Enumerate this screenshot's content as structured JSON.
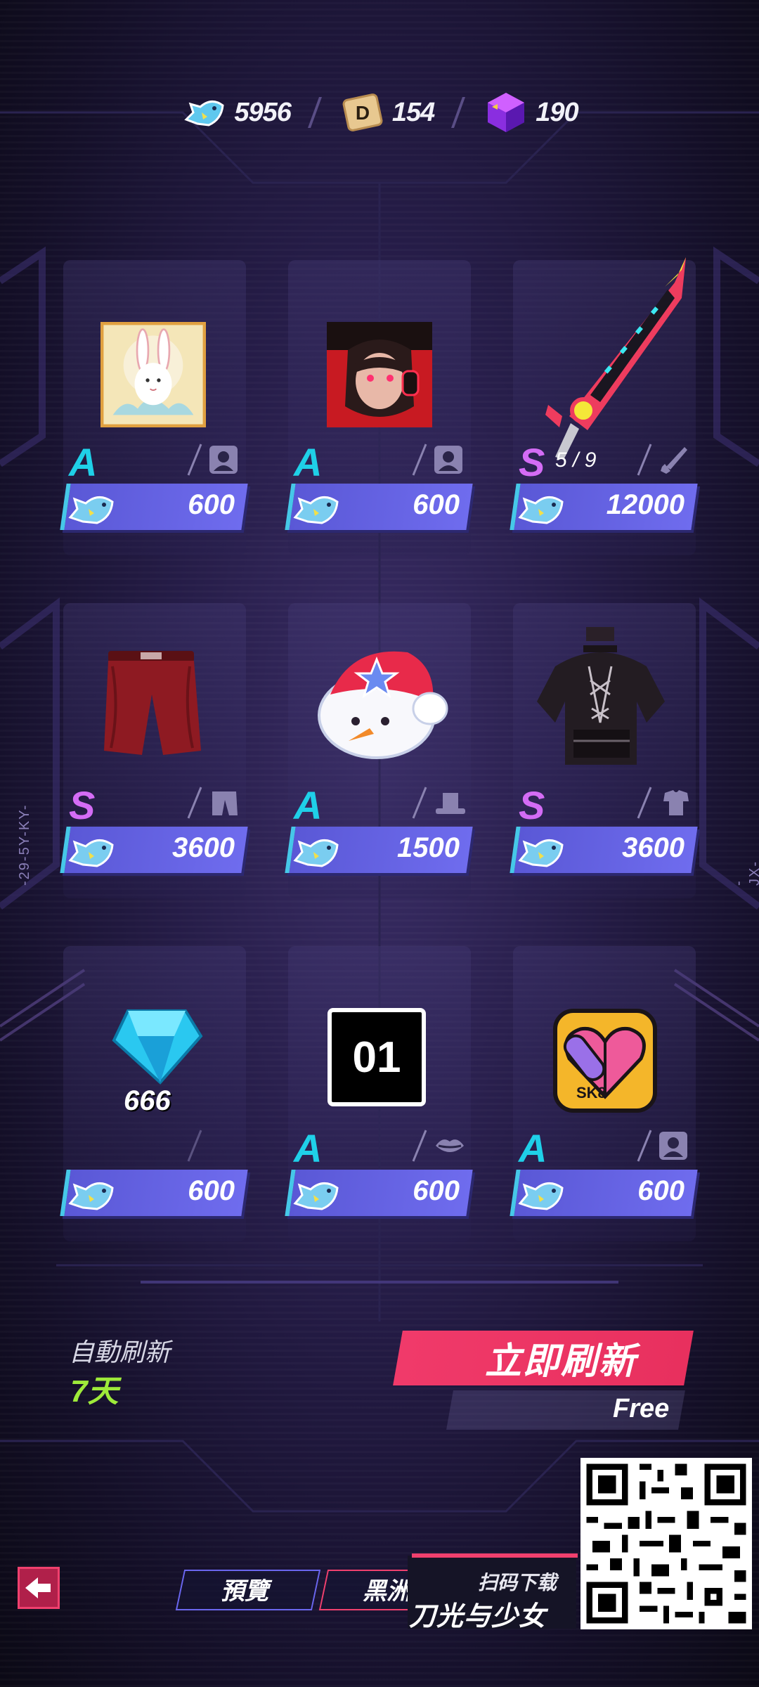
{
  "currencies": [
    {
      "icon": "blue-fish-icon",
      "value": "5956"
    },
    {
      "icon": "d-coin-icon",
      "value": "154"
    },
    {
      "icon": "purple-cube-icon",
      "value": "190"
    }
  ],
  "items": [
    {
      "art": "bunny-portrait-icon",
      "grade": "A",
      "progress": "",
      "type_icon": "avatar-type-icon",
      "price": "600"
    },
    {
      "art": "red-girl-portrait-icon",
      "grade": "A",
      "progress": "",
      "type_icon": "avatar-type-icon",
      "price": "600"
    },
    {
      "art": "red-blade-weapon-icon",
      "grade": "S",
      "progress": "5 / 9",
      "type_icon": "weapon-type-icon",
      "price": "12000"
    },
    {
      "art": "red-shorts-icon",
      "grade": "S",
      "progress": "",
      "type_icon": "pants-type-icon",
      "price": "3600"
    },
    {
      "art": "snowman-hat-icon",
      "grade": "A",
      "progress": "",
      "type_icon": "hat-type-icon",
      "price": "1500"
    },
    {
      "art": "black-top-icon",
      "grade": "S",
      "progress": "",
      "type_icon": "shirt-type-icon",
      "price": "3600"
    },
    {
      "art": "diamond-icon",
      "grade": "",
      "progress": "",
      "type_icon": "",
      "price": "600",
      "art_count": "666"
    },
    {
      "art": "number-badge-icon",
      "grade": "A",
      "progress": "",
      "type_icon": "lips-type-icon",
      "price": "600",
      "art_text": "01"
    },
    {
      "art": "skateboard-heart-icon",
      "grade": "A",
      "progress": "",
      "type_icon": "avatar-type-icon",
      "price": "600",
      "art_text": "SK8"
    }
  ],
  "refresh": {
    "auto_label": "自動刷新",
    "auto_days": "7天",
    "button_label": "立即刷新",
    "cost_label": "Free"
  },
  "nav": {
    "tab_preview": "預覽",
    "tab_black": "黑洲"
  },
  "promo": {
    "small": "扫码下载",
    "big": "刀光与少女"
  },
  "side_codes": {
    "left": "-29-5Y-KY-",
    "right": "-JX-PD-RN-"
  },
  "colors": {
    "grade_a": "#1fd0e8",
    "grade_s": "#d46cf5",
    "price_bar": "#6f6cee",
    "refresh_button": "#f03a6a",
    "days": "#9eea3a"
  }
}
